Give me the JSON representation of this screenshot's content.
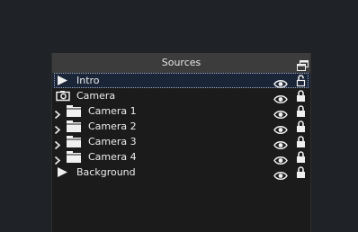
{
  "panel": {
    "title": "Sources",
    "undock_icon": "undock-icon"
  },
  "sources": [
    {
      "label": "Intro",
      "type": "media",
      "icon": "play-icon",
      "selected": true,
      "expandable": false,
      "visible": true,
      "locked": false
    },
    {
      "label": "Camera",
      "type": "camera",
      "icon": "camera-icon",
      "selected": false,
      "expandable": false,
      "visible": true,
      "locked": true
    },
    {
      "label": "Camera 1",
      "type": "group",
      "icon": "folder-icon",
      "selected": false,
      "expandable": true,
      "visible": true,
      "locked": true
    },
    {
      "label": "Camera 2",
      "type": "group",
      "icon": "folder-icon",
      "selected": false,
      "expandable": true,
      "visible": true,
      "locked": true
    },
    {
      "label": "Camera 3",
      "type": "group",
      "icon": "folder-icon",
      "selected": false,
      "expandable": true,
      "visible": true,
      "locked": true
    },
    {
      "label": "Camera 4",
      "type": "group",
      "icon": "folder-icon",
      "selected": false,
      "expandable": true,
      "visible": true,
      "locked": true
    },
    {
      "label": "Background",
      "type": "media",
      "icon": "play-icon",
      "selected": false,
      "expandable": false,
      "visible": true,
      "locked": true
    }
  ],
  "colors": {
    "background": "#1f2227",
    "panel": "#1b1b1b",
    "header": "#3c3c3c",
    "selected_row": "#1b2538",
    "icon": "#f0f0f0"
  }
}
